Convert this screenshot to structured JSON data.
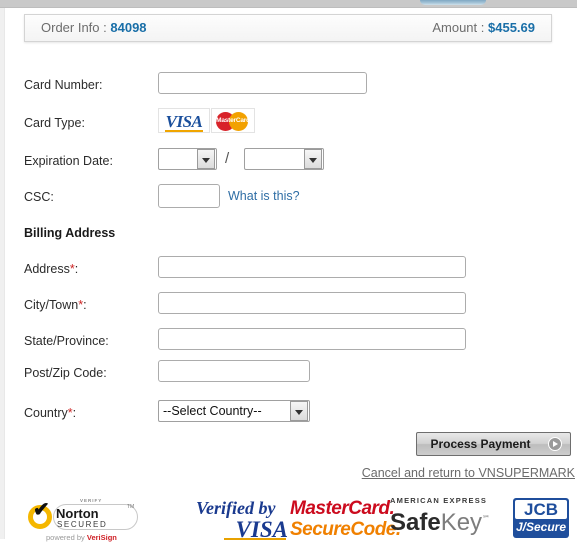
{
  "order_bar": {
    "order_label": "Order Info :",
    "order_value": "84098",
    "amount_label": "Amount :",
    "amount_value": "$455.69",
    "accent_color": "#1a6fa8"
  },
  "payment_section": {
    "card_number_label": "Card Number:",
    "card_number_value": "",
    "card_type_label": "Card Type:",
    "card_brands": [
      "VISA",
      "MasterCard"
    ],
    "expiration_label": "Expiration Date:",
    "expiration_month_value": "",
    "expiration_year_value": "",
    "expiration_separator": "/",
    "csc_label": "CSC:",
    "csc_value": "",
    "csc_help_link": "What is this?"
  },
  "billing_section": {
    "title": "Billing Address",
    "address_label": "Address",
    "address_required": "*",
    "address_suffix": ":",
    "address_value": "",
    "city_label": "City/Town",
    "city_required": "*",
    "city_suffix": ":",
    "city_value": "",
    "state_label": "State/Province:",
    "state_value": "",
    "zip_label": "Post/Zip Code:",
    "zip_value": "",
    "country_label": "Country",
    "country_required": "*",
    "country_suffix": ":",
    "country_value": "--Select Country--"
  },
  "actions": {
    "submit_label": "Process Payment",
    "cancel_label": "Cancel and return to VNSUPERMARK"
  },
  "badges": {
    "norton": {
      "verify": "VERIFY",
      "name": "Norton",
      "secured": "SECURED",
      "tm": "TM",
      "powered_prefix": "powered by ",
      "powered_brand": "VeriSign",
      "check": "✔"
    },
    "verified_by_visa": {
      "line1": "Verified by",
      "line2": "VISA"
    },
    "mastercard_securecode": {
      "line1": "MasterCard.",
      "line2": "SecureCode."
    },
    "amex_safekey": {
      "eyebrow": "AMERICAN EXPRESS",
      "safe": "Safe",
      "key": "Key",
      "sm": "℠"
    },
    "jcb": {
      "line1": "JCB",
      "line2": "J/Secure"
    }
  }
}
